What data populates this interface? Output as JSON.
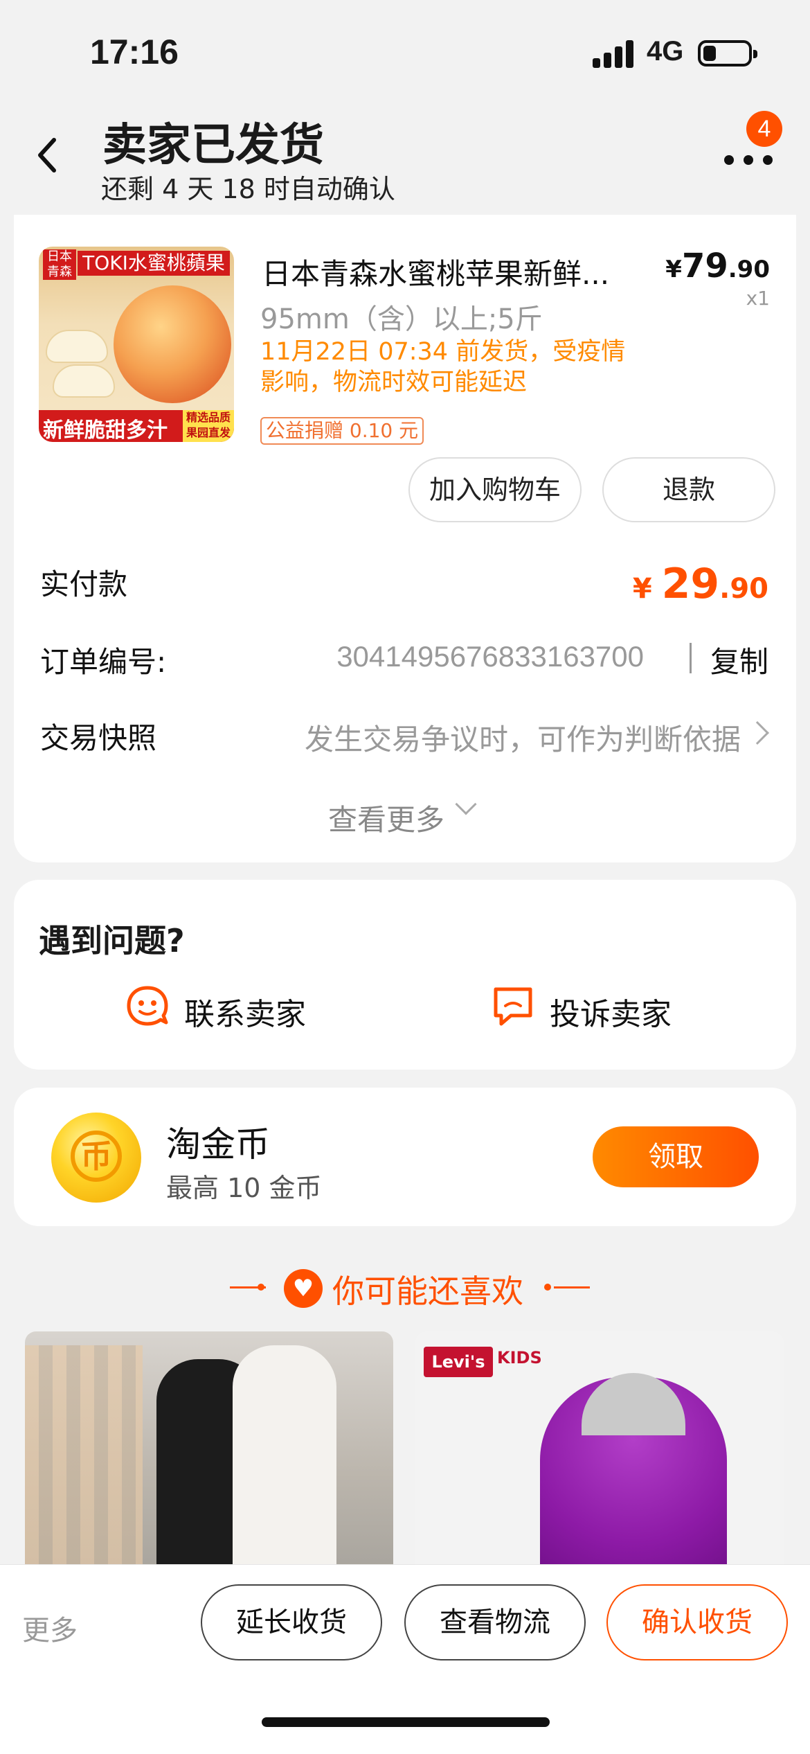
{
  "status_bar": {
    "time": "17:16",
    "network": "4G"
  },
  "header": {
    "title": "卖家已发货",
    "subtitle": "还剩 4 天 18 时自动确认",
    "badge_count": "4"
  },
  "order_item": {
    "thumb_tag_left": "日本青森",
    "thumb_tag_top": "TOKI水蜜桃蘋果",
    "thumb_bottom_text": "新鲜脆甜多汁",
    "thumb_bottom_badge": "精选品质果园直发",
    "name": "日本青森水蜜桃苹果新鲜...",
    "price_symbol": "¥",
    "price_int": "79",
    "price_dec": ".90",
    "quantity": "x1",
    "spec": "95mm（含）以上;5斤",
    "shipping_note": "11月22日 07:34 前发货，受疫情影响，物流时效可能延迟",
    "donation": "公益捐赠 0.10 元",
    "add_cart_label": "加入购物车",
    "refund_label": "退款"
  },
  "order_info": {
    "paid_label": "实付款",
    "paid_symbol": "¥ ",
    "paid_int": "29",
    "paid_dec": ".90",
    "order_no_label": "订单编号:",
    "order_no": "3041495676833163700",
    "copy_label": "复制",
    "snapshot_label": "交易快照",
    "snapshot_hint": "发生交易争议时，可作为判断依据",
    "see_more": "查看更多"
  },
  "help": {
    "title": "遇到问题?",
    "contact_label": "联系卖家",
    "complain_label": "投诉卖家"
  },
  "coins": {
    "icon_char": "币",
    "title": "淘金币",
    "subtitle": "最高 10 金币",
    "claim_label": "领取"
  },
  "recommend": {
    "title": "你可能还喜欢",
    "brand_badge": "Levi's",
    "brand_kids": "KIDS"
  },
  "bottom_bar": {
    "more_label": "更多",
    "extend_label": "延长收货",
    "logistics_label": "查看物流",
    "confirm_label": "确认收货"
  },
  "colors": {
    "accent": "#ff5000",
    "warning": "#ff8a00"
  }
}
